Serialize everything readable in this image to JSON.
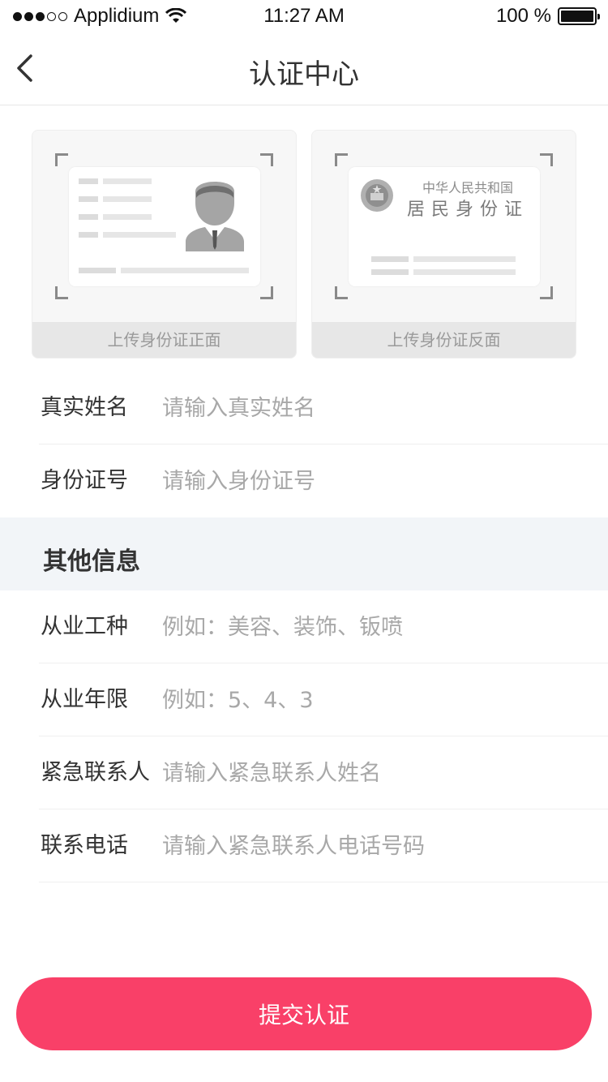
{
  "status_bar": {
    "carrier": "Applidium",
    "time": "11:27 AM",
    "battery": "100 %"
  },
  "nav": {
    "title": "认证中心"
  },
  "id_upload": {
    "front_caption": "上传身份证正面",
    "back_caption": "上传身份证反面",
    "back_card_line1": "中华人民共和国",
    "back_card_line2": "居民身份证"
  },
  "form": {
    "rows": [
      {
        "label": "真实姓名",
        "placeholder": "请输入真实姓名"
      },
      {
        "label": "身份证号",
        "placeholder": "请输入身份证号"
      }
    ]
  },
  "section": {
    "title": "其他信息"
  },
  "other": {
    "rows": [
      {
        "label": "从业工种",
        "placeholder": "例如：美容、装饰、钣喷"
      },
      {
        "label": "从业年限",
        "placeholder": "例如：5、4、3"
      },
      {
        "label": "紧急联系人",
        "placeholder": "请输入紧急联系人姓名"
      },
      {
        "label": "联系电话",
        "placeholder": "请输入紧急联系人电话号码"
      }
    ]
  },
  "submit": {
    "label": "提交认证"
  },
  "colors": {
    "accent": "#f94068",
    "section_bg": "#f2f5f8"
  }
}
